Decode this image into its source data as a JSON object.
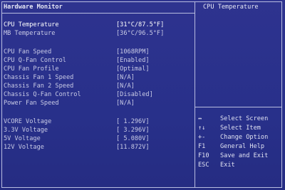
{
  "title": "Hardware Monitor",
  "help_title": "CPU Temperature",
  "items": [
    {
      "label": "CPU Temperature",
      "value": "[31°C/87.5°F]",
      "highlight": true
    },
    {
      "label": "MB Temperature",
      "value": "[36°C/96.5°F]"
    },
    {
      "label": "CPU Fan Speed",
      "value": "[1068RPM]"
    },
    {
      "label": "CPU Q-Fan Control",
      "value": "[Enabled]"
    },
    {
      "label": "CPU Fan Profile",
      "value": "[Optimal]"
    },
    {
      "label": "Chassis Fan 1 Speed",
      "value": "[N/A]"
    },
    {
      "label": "Chassis Fan 2 Speed",
      "value": "[N/A]"
    },
    {
      "label": "Chassis Q-Fan Control",
      "value": "[Disabled]"
    },
    {
      "label": "Power Fan Speed",
      "value": "[N/A]"
    },
    {
      "label": "VCORE  Voltage",
      "value": "[ 1.296V]"
    },
    {
      "label": "3.3V  Voltage",
      "value": "[ 3.296V]"
    },
    {
      "label": "5V  Voltage",
      "value": "[ 5.080V]"
    },
    {
      "label": "12V  Voltage",
      "value": "[11.872V]"
    }
  ],
  "nav": [
    {
      "key": "↔",
      "desc": "Select Screen"
    },
    {
      "key": "↑↓",
      "desc": "Select Item"
    },
    {
      "key": "+-",
      "desc": "Change Option"
    },
    {
      "key": "F1",
      "desc": "General Help"
    },
    {
      "key": "F10",
      "desc": "Save and Exit"
    },
    {
      "key": "ESC",
      "desc": "Exit"
    }
  ]
}
